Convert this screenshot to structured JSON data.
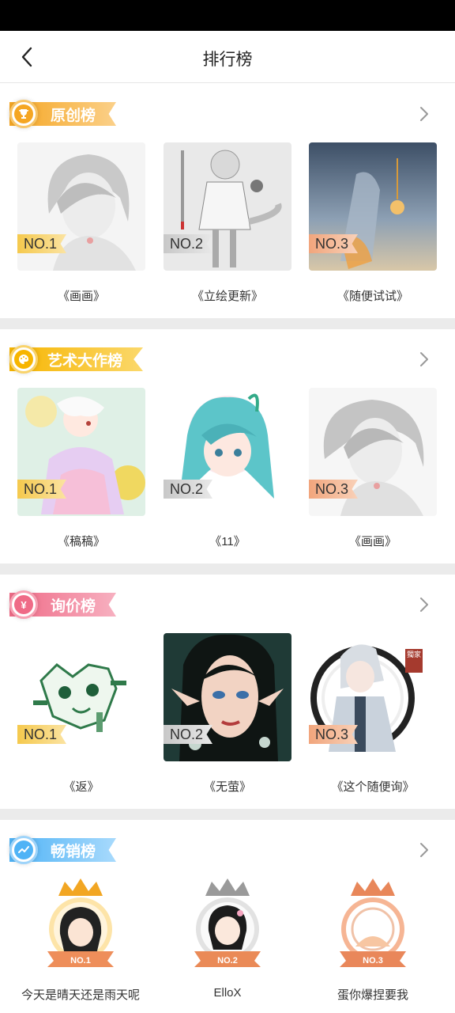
{
  "header": {
    "title": "排行榜"
  },
  "sections": [
    {
      "name": "原创榜",
      "color": "#f5a623",
      "items": [
        {
          "rank": "NO.1",
          "title": "《画画》"
        },
        {
          "rank": "NO.2",
          "title": "《立绘更新》"
        },
        {
          "rank": "NO.3",
          "title": "《随便试试》"
        }
      ]
    },
    {
      "name": "艺术大作榜",
      "color": "#f7b500",
      "items": [
        {
          "rank": "NO.1",
          "title": "《稿稿》"
        },
        {
          "rank": "NO.2",
          "title": "《11》"
        },
        {
          "rank": "NO.3",
          "title": "《画画》"
        }
      ]
    },
    {
      "name": "询价榜",
      "color": "#ef6b87",
      "items": [
        {
          "rank": "NO.1",
          "title": "《返》"
        },
        {
          "rank": "NO.2",
          "title": "《无萤》"
        },
        {
          "rank": "NO.3",
          "title": "《这个随便询》"
        }
      ]
    },
    {
      "name": "畅销榜",
      "color": "#4fb3f6",
      "sellers": [
        {
          "rank": "NO.1",
          "name": "今天是晴天还是雨天呢"
        },
        {
          "rank": "NO.2",
          "name": "ElloX"
        },
        {
          "rank": "NO.3",
          "name": "蛋你爆捏要我"
        }
      ]
    }
  ],
  "seal_text": "獨家"
}
